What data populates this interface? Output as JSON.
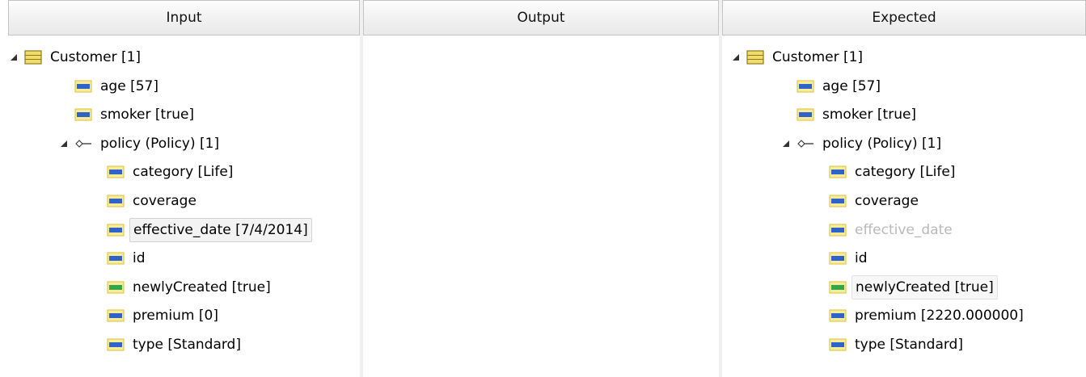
{
  "panes": {
    "input": {
      "title": "Input",
      "items": [
        {
          "label": "Customer [1]",
          "depth": 0,
          "icon": "entity-icon",
          "expander": true
        },
        {
          "label": "age [57]",
          "depth": 1,
          "icon": "attribute-icon"
        },
        {
          "label": "smoker [true]",
          "depth": 1,
          "icon": "attribute-icon"
        },
        {
          "label": "policy (Policy) [1]",
          "depth": 1,
          "icon": "relation-icon",
          "expander": true
        },
        {
          "label": "category [Life]",
          "depth": 2,
          "icon": "attribute-icon"
        },
        {
          "label": "coverage",
          "depth": 2,
          "icon": "attribute-icon"
        },
        {
          "label": "effective_date [7/4/2014]",
          "depth": 2,
          "icon": "attribute-icon",
          "state": "selected"
        },
        {
          "label": "id",
          "depth": 2,
          "icon": "attribute-icon"
        },
        {
          "label": "newlyCreated [true]",
          "depth": 2,
          "icon": "attribute-green-icon"
        },
        {
          "label": "premium [0]",
          "depth": 2,
          "icon": "attribute-icon"
        },
        {
          "label": "type [Standard]",
          "depth": 2,
          "icon": "attribute-icon"
        }
      ]
    },
    "output": {
      "title": "Output",
      "items": []
    },
    "expected": {
      "title": "Expected",
      "items": [
        {
          "label": "Customer [1]",
          "depth": 0,
          "icon": "entity-icon",
          "expander": true
        },
        {
          "label": "age [57]",
          "depth": 1,
          "icon": "attribute-icon"
        },
        {
          "label": "smoker [true]",
          "depth": 1,
          "icon": "attribute-icon"
        },
        {
          "label": "policy (Policy) [1]",
          "depth": 1,
          "icon": "relation-icon",
          "expander": true
        },
        {
          "label": "category [Life]",
          "depth": 2,
          "icon": "attribute-icon"
        },
        {
          "label": "coverage",
          "depth": 2,
          "icon": "attribute-icon"
        },
        {
          "label": "effective_date",
          "depth": 2,
          "icon": "attribute-icon",
          "state": "dim"
        },
        {
          "label": "id",
          "depth": 2,
          "icon": "attribute-icon"
        },
        {
          "label": "newlyCreated [true]",
          "depth": 2,
          "icon": "attribute-green-icon",
          "state": "hover"
        },
        {
          "label": "premium [2220.000000]",
          "depth": 2,
          "icon": "attribute-icon"
        },
        {
          "label": "type [Standard]",
          "depth": 2,
          "icon": "attribute-icon"
        }
      ]
    }
  },
  "colors": {
    "entity_fill": "#f2dc6a",
    "entity_border": "#8a7a1e",
    "attribute_bar": "#2f63c9",
    "attribute_green_bar": "#2fa84a",
    "attribute_frame": "#e0c84c"
  }
}
